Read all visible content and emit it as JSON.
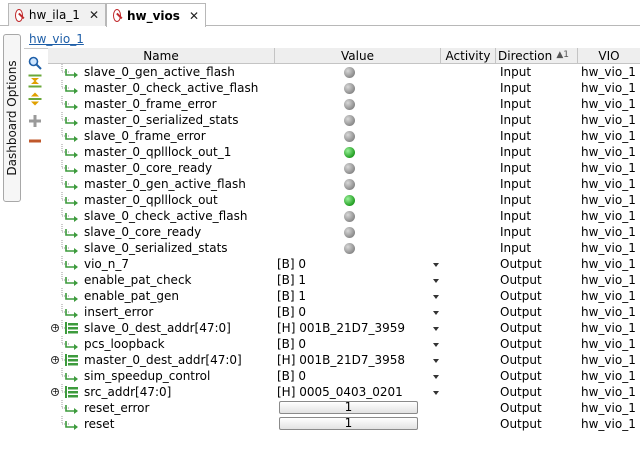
{
  "tabs": [
    {
      "label": "hw_ila_1",
      "close": "✕",
      "active": false
    },
    {
      "label": "hw_vios",
      "close": "✕",
      "active": true
    }
  ],
  "side_tab": {
    "label": "Dashboard Options"
  },
  "panel": {
    "title": "hw_vio_1"
  },
  "toolbar": [
    {
      "name": "search-icon"
    },
    {
      "name": "collapse-all-icon"
    },
    {
      "name": "expand-all-icon"
    },
    {
      "name": "add-icon"
    },
    {
      "name": "remove-icon"
    }
  ],
  "columns": {
    "name": "Name",
    "value": "Value",
    "activity": "Activity",
    "direction": "Direction",
    "sort_marker": "1",
    "vio": "VIO"
  },
  "rows": [
    {
      "name": "slave_0_gen_active_flash",
      "type": "led",
      "led": "gray",
      "direction": "Input",
      "vio": "hw_vio_1",
      "bus": false
    },
    {
      "name": "master_0_check_active_flash",
      "type": "led",
      "led": "gray",
      "direction": "Input",
      "vio": "hw_vio_1",
      "bus": false
    },
    {
      "name": "master_0_frame_error",
      "type": "led",
      "led": "gray",
      "direction": "Input",
      "vio": "hw_vio_1",
      "bus": false
    },
    {
      "name": "master_0_serialized_stats",
      "type": "led",
      "led": "gray",
      "direction": "Input",
      "vio": "hw_vio_1",
      "bus": false
    },
    {
      "name": "slave_0_frame_error",
      "type": "led",
      "led": "gray",
      "direction": "Input",
      "vio": "hw_vio_1",
      "bus": false
    },
    {
      "name": "master_0_qplllock_out_1",
      "type": "led",
      "led": "green",
      "direction": "Input",
      "vio": "hw_vio_1",
      "bus": false
    },
    {
      "name": "master_0_core_ready",
      "type": "led",
      "led": "gray",
      "direction": "Input",
      "vio": "hw_vio_1",
      "bus": false
    },
    {
      "name": "master_0_gen_active_flash",
      "type": "led",
      "led": "gray",
      "direction": "Input",
      "vio": "hw_vio_1",
      "bus": false
    },
    {
      "name": "master_0_qplllock_out",
      "type": "led",
      "led": "green",
      "direction": "Input",
      "vio": "hw_vio_1",
      "bus": false
    },
    {
      "name": "slave_0_check_active_flash",
      "type": "led",
      "led": "gray",
      "direction": "Input",
      "vio": "hw_vio_1",
      "bus": false
    },
    {
      "name": "slave_0_core_ready",
      "type": "led",
      "led": "gray",
      "direction": "Input",
      "vio": "hw_vio_1",
      "bus": false
    },
    {
      "name": "slave_0_serialized_stats",
      "type": "led",
      "led": "gray",
      "direction": "Input",
      "vio": "hw_vio_1",
      "bus": false
    },
    {
      "name": "vio_n_7",
      "type": "dropdown",
      "value": "[B] 0",
      "direction": "Output",
      "vio": "hw_vio_1",
      "bus": false
    },
    {
      "name": "enable_pat_check",
      "type": "dropdown",
      "value": "[B] 1",
      "direction": "Output",
      "vio": "hw_vio_1",
      "bus": false
    },
    {
      "name": "enable_pat_gen",
      "type": "dropdown",
      "value": "[B] 1",
      "direction": "Output",
      "vio": "hw_vio_1",
      "bus": false
    },
    {
      "name": "insert_error",
      "type": "dropdown",
      "value": "[B] 0",
      "direction": "Output",
      "vio": "hw_vio_1",
      "bus": false
    },
    {
      "name": "slave_0_dest_addr[47:0]",
      "type": "dropdown",
      "value": "[H] 001B_21D7_3959",
      "direction": "Output",
      "vio": "hw_vio_1",
      "bus": true
    },
    {
      "name": "pcs_loopback",
      "type": "dropdown",
      "value": "[B] 0",
      "direction": "Output",
      "vio": "hw_vio_1",
      "bus": false
    },
    {
      "name": "master_0_dest_addr[47:0]",
      "type": "dropdown",
      "value": "[H] 001B_21D7_3958",
      "direction": "Output",
      "vio": "hw_vio_1",
      "bus": true
    },
    {
      "name": "sim_speedup_control",
      "type": "dropdown",
      "value": "[B] 0",
      "direction": "Output",
      "vio": "hw_vio_1",
      "bus": false
    },
    {
      "name": "src_addr[47:0]",
      "type": "dropdown",
      "value": "[H] 0005_0403_0201",
      "direction": "Output",
      "vio": "hw_vio_1",
      "bus": true
    },
    {
      "name": "reset_error",
      "type": "button",
      "value": "1",
      "direction": "Output",
      "vio": "hw_vio_1",
      "bus": false
    },
    {
      "name": "reset",
      "type": "button",
      "value": "1",
      "direction": "Output",
      "vio": "hw_vio_1",
      "bus": false
    }
  ],
  "colors": {
    "link": "#1f5fa8",
    "led_gray": "#8a8a8a",
    "led_green": "#2aa52a",
    "signal_icon": "#3d9b3d",
    "tab_icon": "#c0282b"
  }
}
